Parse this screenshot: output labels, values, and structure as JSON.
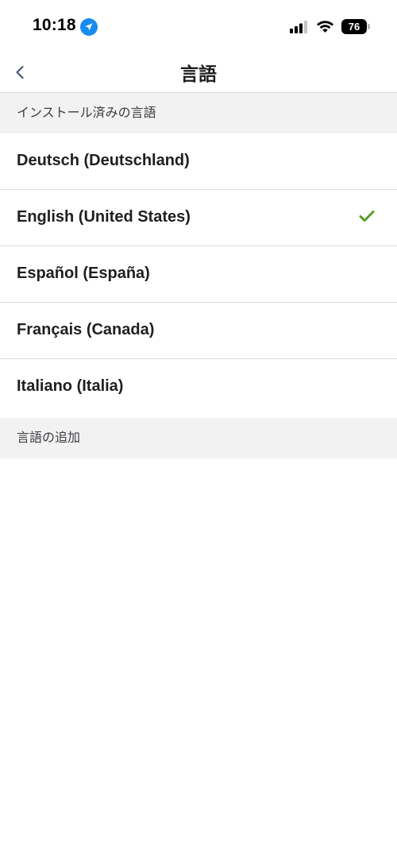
{
  "status_bar": {
    "time": "10:18",
    "battery": "76"
  },
  "nav": {
    "title": "言語"
  },
  "installed_section": {
    "title": "インストール済みの言語",
    "languages": [
      {
        "label": "Deutsch (Deutschland)",
        "selected": false
      },
      {
        "label": "English (United States)",
        "selected": true
      },
      {
        "label": "Español (España)",
        "selected": false
      },
      {
        "label": "Français (Canada)",
        "selected": false
      },
      {
        "label": "Italiano (Italia)",
        "selected": false
      }
    ]
  },
  "add_section": {
    "title": "言語の追加"
  },
  "colors": {
    "accent_blue": "#1a8cf0",
    "check_green": "#5a9e2a",
    "back_chevron": "#48587a"
  },
  "icons": {
    "location": "location-arrow-icon",
    "signal": "cellular-signal-icon",
    "wifi": "wifi-icon",
    "back": "chevron-left-icon",
    "check": "checkmark-icon"
  }
}
